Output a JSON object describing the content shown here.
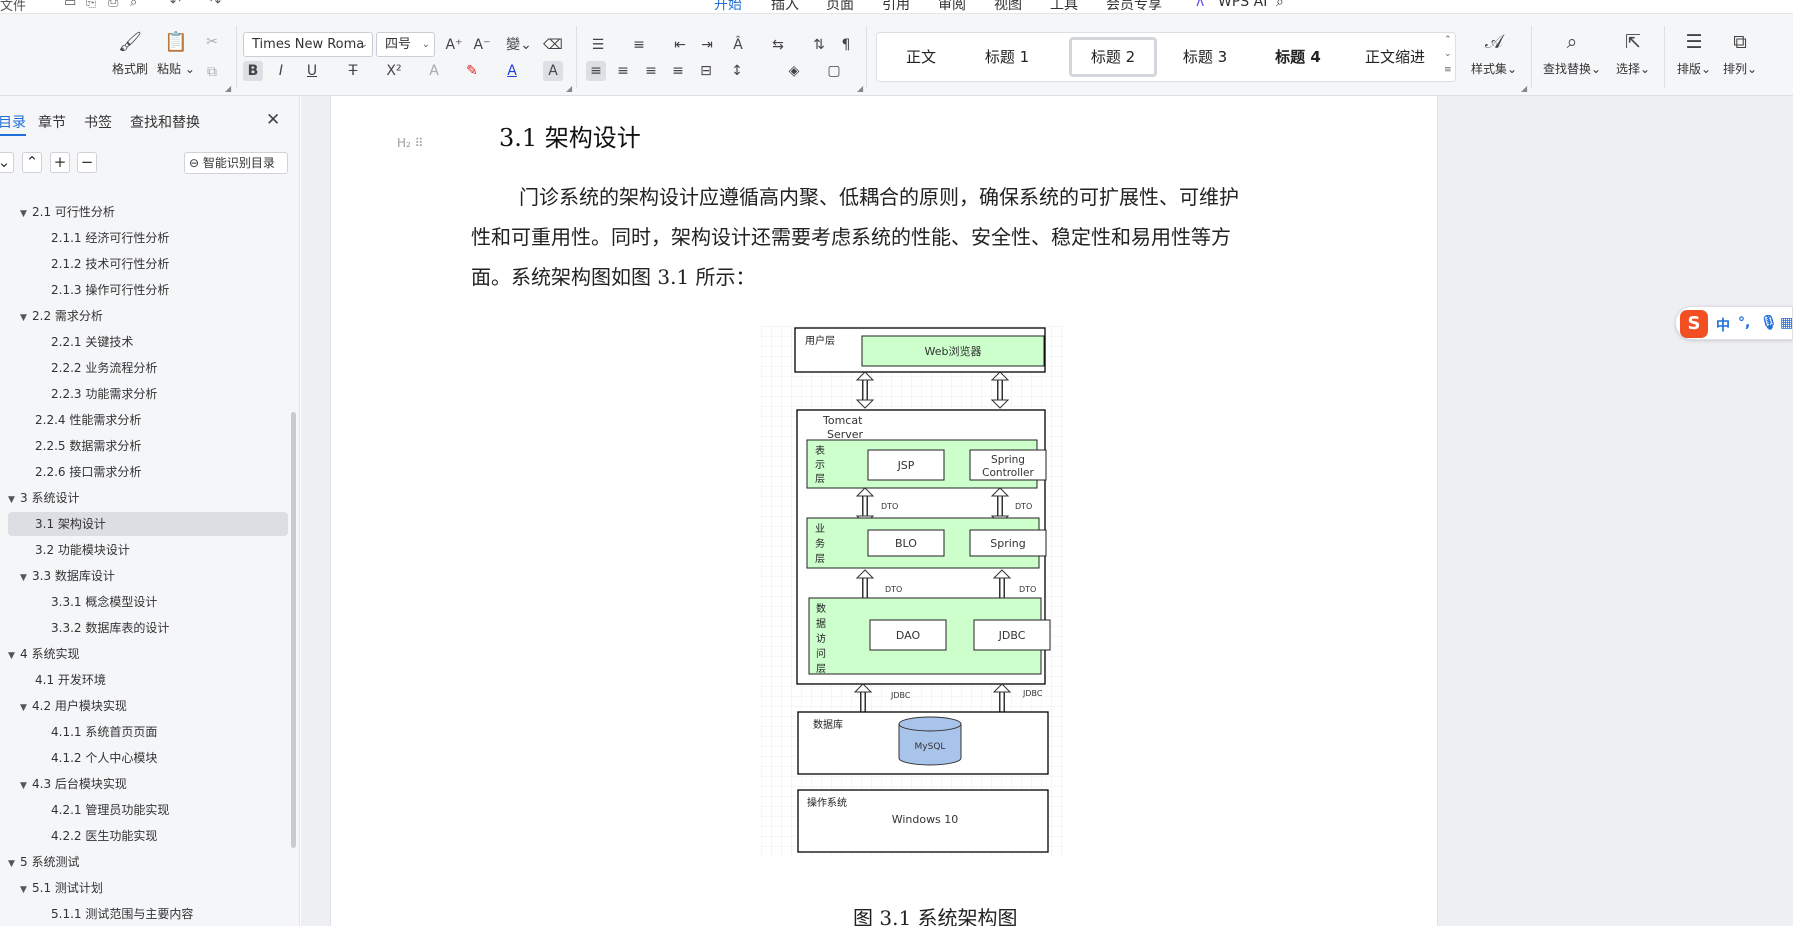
{
  "quick_access": {
    "file_menu": "文件"
  },
  "menu": {
    "tabs": [
      {
        "label": "开始",
        "active": true
      },
      {
        "label": "插入"
      },
      {
        "label": "页面"
      },
      {
        "label": "引用"
      },
      {
        "label": "审阅"
      },
      {
        "label": "视图"
      },
      {
        "label": "工具"
      },
      {
        "label": "会员专享"
      }
    ],
    "ai_label": "WPS AI"
  },
  "ribbon": {
    "format_painter": "格式刷",
    "paste": "粘贴",
    "font_name": "Times New Roma",
    "font_size": "四号",
    "styles": [
      {
        "label": "正文"
      },
      {
        "label": "标题 1"
      },
      {
        "label": "标题 2",
        "active": true
      },
      {
        "label": "标题 3"
      },
      {
        "label": "标题 4",
        "bold": true
      },
      {
        "label": "正文缩进"
      }
    ],
    "style_set": "样式集",
    "find_replace": "查找替换",
    "select": "选择",
    "layout": "排版",
    "arrange": "排列",
    "accent_color": "#1f6fd9"
  },
  "nav": {
    "tabs": [
      "目录",
      "章节",
      "书签",
      "查找和替换"
    ],
    "smart_toc_label": "智能识别目录",
    "items": [
      {
        "label": "2.1  可行性分析"
      },
      {
        "label": "2.1.1  经济可行性分析"
      },
      {
        "label": "2.1.2  技术可行性分析"
      },
      {
        "label": "2.1.3  操作可行性分析"
      },
      {
        "label": "2.2  需求分析"
      },
      {
        "label": "2.2.1 关键技术"
      },
      {
        "label": "2.2.2  业务流程分析"
      },
      {
        "label": "2.2.3  功能需求分析"
      },
      {
        "label": "2.2.4  性能需求分析"
      },
      {
        "label": "2.2.5  数据需求分析"
      },
      {
        "label": "2.2.6  接口需求分析"
      },
      {
        "label": "3  系统设计"
      },
      {
        "label": "3.1  架构设计",
        "active": true
      },
      {
        "label": "3.2  功能模块设计"
      },
      {
        "label": "3.3  数据库设计"
      },
      {
        "label": "3.3.1  概念模型设计"
      },
      {
        "label": "3.3.2  数据库表的设计"
      },
      {
        "label": "4  系统实现"
      },
      {
        "label": "4.1  开发环境"
      },
      {
        "label": "4.2  用户模块实现"
      },
      {
        "label": "4.1.1 系统首页页面"
      },
      {
        "label": "4.1.2 个人中心模块"
      },
      {
        "label": "4.3 后台模块实现"
      },
      {
        "label": "4.2.1 管理员功能实现"
      },
      {
        "label": "4.2.2 医生功能实现"
      },
      {
        "label": "5  系统测试"
      },
      {
        "label": "5.1  测试计划"
      },
      {
        "label": "5.1.1  测试范围与主要内容"
      }
    ]
  },
  "document": {
    "heading_marker": "H₂",
    "heading": "3.1  架构设计",
    "paragraph_lines": [
      "门诊系统的架构设计应遵循高内聚、低耦合的原则，确保系统的可扩展性、可维护",
      "性和可重用性。同时，架构设计还需要考虑系统的性能、安全性、稳定性和易用性等方",
      "面。系统架构图如图 3.1 所示："
    ],
    "figure_caption": "图 3.1  系统架构图"
  },
  "diagram": {
    "user_layer": "用户层",
    "browser": "Web浏览器",
    "server_line1": "Tomcat",
    "server_line2": "Server",
    "presentation_layer": "表示层",
    "jsp": "JSP",
    "spring_controller_line1": "Spring",
    "spring_controller_line2": "Controller",
    "business_layer": "业务层",
    "blo": "BLO",
    "spring": "Spring",
    "data_access_layer": "数据访问层",
    "dao": "DAO",
    "jdbc": "JDBC",
    "dto": "DTO",
    "jdbc_link": "JDBC",
    "database": "数据库",
    "mysql": "MySQL",
    "os": "操作系统",
    "windows": "Windows 10",
    "layer_fill": "#ccffcc",
    "db_fill": "#a9c4eb"
  },
  "ime": {
    "logo": "S",
    "mode": "中"
  }
}
